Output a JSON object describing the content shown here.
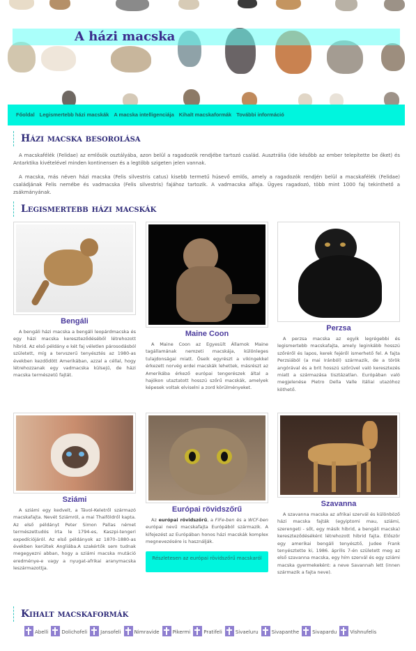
{
  "header": {
    "title": "A házi macska"
  },
  "nav": {
    "items": [
      "Főoldal",
      "Legismertebb házi macskák",
      "A macska intelligenciája",
      "Kihalt macskaformák",
      "További információ"
    ]
  },
  "section1": {
    "heading": "Házi macska besorolása",
    "para1": "A macskafélék (Felidae) az emlősök osztályába, azon belül a ragadozók rendjébe tartozó család. Ausztrália (ide később az ember telepítette be őket) és Antarktika kivételével minden kontinensen és a legtöbb szigeten jelen vannak.",
    "para2": "A macska, más néven házi macska (Felis silvestris catus) kisebb termetű húsevő emlős, amely a ragadozók rendjén belül a macskafélék (Felidae) családjának Felis nemébe és vadmacska (Felis silvestris) fajához tartozik. A vadmacska alfaja. Ügyes ragadozó, több mint 1000 faj tekinthető a zsákmányának."
  },
  "section2": {
    "heading": "Legismertebb házi macskák",
    "cards": [
      {
        "name": "Bengáli",
        "desc": "A bengáli házi macska a bengáli leopárdmacska és egy házi macska kereszteződéséből létrehozott hibrid. Az első példány e két faj véletlen párosodásból született, míg a tervszerű tenyésztés az 1980-as években kezdődött Amerikában, azzal a céllal, hogy létrehozzanak egy vadmacska külsejű, de házi macska természetű fajtát."
      },
      {
        "name": "Maine Coon",
        "desc": "A Maine Coon az Egyesült Államok Maine tagállamának nemzeti macskája, különleges tulajdonságai miatt. Őseik egyrészt a vikingekkel érkezett norvég erdei macskák lehettek, másrészt az Amerikába érkező európai tengerészek által a hajókon utaztatott hosszú szőrű macskák, amelyek képesek voltak elviselni a zord körülményeket."
      },
      {
        "name": "Perzsa",
        "desc": "A perzsa macska az egyik legrégebbi és legismertebb macskafajta, amely leginkább hosszú szőréről és lapos, kerek fejéről ismerhető fel. A fajta Perzsiából (a mai Iránból) származik, de a török angórával és a brit hosszú szőrűvel való keresztezés miatt a származása tisztázatlan. Európában való megjelenése Pietro Della Valle itáliai utazóhoz köthető."
      },
      {
        "name": "Sziámi",
        "desc": "A sziámi egy kedvelt, a Távol-Keletről származó macskafajta. Nevét Sziámról, a mai Thaiföldről kapta. Az első példányt Peter Simon Pallas német természettudós írta le 1794-es, Kaszpi-tengeri expedíciójáról. Az első példányok az 1870–1880-as években kerültek Angliába.A szakértők sem tudnak megegyezni abban, hogy a sziámi macska mutáció eredménye-e vagy a nyugat-afrikai aranymacska leszármazottja."
      },
      {
        "name": "Európai rövidszőrű",
        "desc_pre": "Az ",
        "desc_bold": "európai rövidszőrű",
        "desc_mid": ", a ",
        "desc_it1": "FiFe-ben",
        "desc_and": " és a ",
        "desc_it2": "WCF-ben",
        "desc_post": " európai nevű macskafajta Európából származik. A kifejezést az Európában honos házi macskák komplex megnevezésére is használják.",
        "cta": "Részletesen az európai rövidszőrű macskaról"
      },
      {
        "name": "Szavanna",
        "desc": "A szavanna macska az afrikai szervál és különböző házi macska fajták (egyiptomi mau, sziámi, szerengeti - sőt, egy másik hibrid, a bengáli macska) kereszteződéséként létrehozott hibrid fajta. Először egy amerikai bengáli tenyésztő, Judee Frank tenyésztette ki, 1986. április 7-én született meg az első szavanna macska, egy hím szervál és egy sziámi macska gyermekeként: a neve Savannah lett (innen származik a fajta neve)."
      }
    ]
  },
  "section3": {
    "heading": "Kihalt macskaformák",
    "items": [
      "Abelli",
      "Dolichofeli",
      "Jansofeli",
      "Nimravide",
      "Pikermi",
      "Pratifeli",
      "Sivaeluru",
      "Sivapanthe",
      "Sivapardu",
      "Vishnufelis"
    ]
  },
  "colors": {
    "accent": "#00f5de",
    "title": "#3b2b8c",
    "cross": "#8f7fd0"
  },
  "icons": [
    "cross-icon"
  ]
}
